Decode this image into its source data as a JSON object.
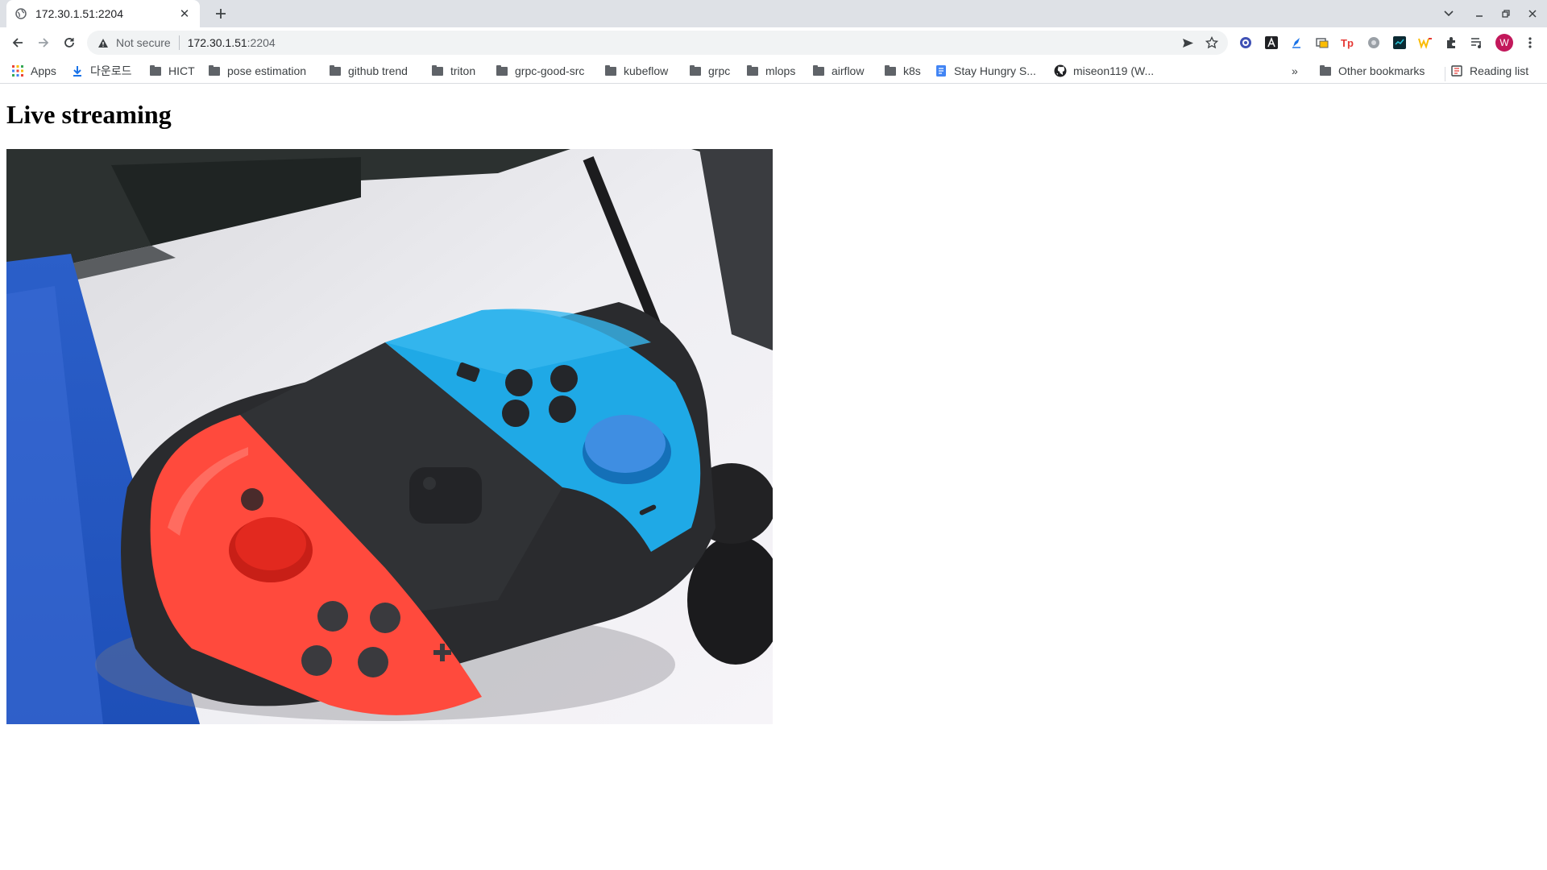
{
  "browser": {
    "tab": {
      "title": "172.30.1.51:2204"
    },
    "omnibox": {
      "security_label": "Not secure",
      "url_host": "172.30.1.51",
      "url_port": ":2204"
    },
    "profile_initial": "W",
    "bookmarks": [
      {
        "label": "Apps",
        "icon": "apps-grid-icon"
      },
      {
        "label": "다운로드",
        "icon": "download-icon"
      },
      {
        "label": "HICT",
        "icon": "folder-icon"
      },
      {
        "label": "pose estimation",
        "icon": "folder-icon"
      },
      {
        "label": "github trend",
        "icon": "folder-icon"
      },
      {
        "label": "triton",
        "icon": "folder-icon"
      },
      {
        "label": "grpc-good-src",
        "icon": "folder-icon"
      },
      {
        "label": "kubeflow",
        "icon": "folder-icon"
      },
      {
        "label": "grpc",
        "icon": "folder-icon"
      },
      {
        "label": "mlops",
        "icon": "folder-icon"
      },
      {
        "label": "airflow",
        "icon": "folder-icon"
      },
      {
        "label": "k8s",
        "icon": "folder-icon"
      },
      {
        "label": "Stay Hungry S...",
        "icon": "doc-icon"
      },
      {
        "label": "miseon119 (W...",
        "icon": "github-icon"
      }
    ],
    "overflow": "»",
    "other_bookmarks": "Other bookmarks",
    "reading_list": "Reading list"
  },
  "page": {
    "title": "Live streaming"
  },
  "colors": {
    "tabstrip": "#dee1e6",
    "omnibox": "#f1f3f4",
    "joycon_red": "#ff4a3d",
    "joycon_blue": "#1fa9e6",
    "profile": "#c2185b"
  }
}
